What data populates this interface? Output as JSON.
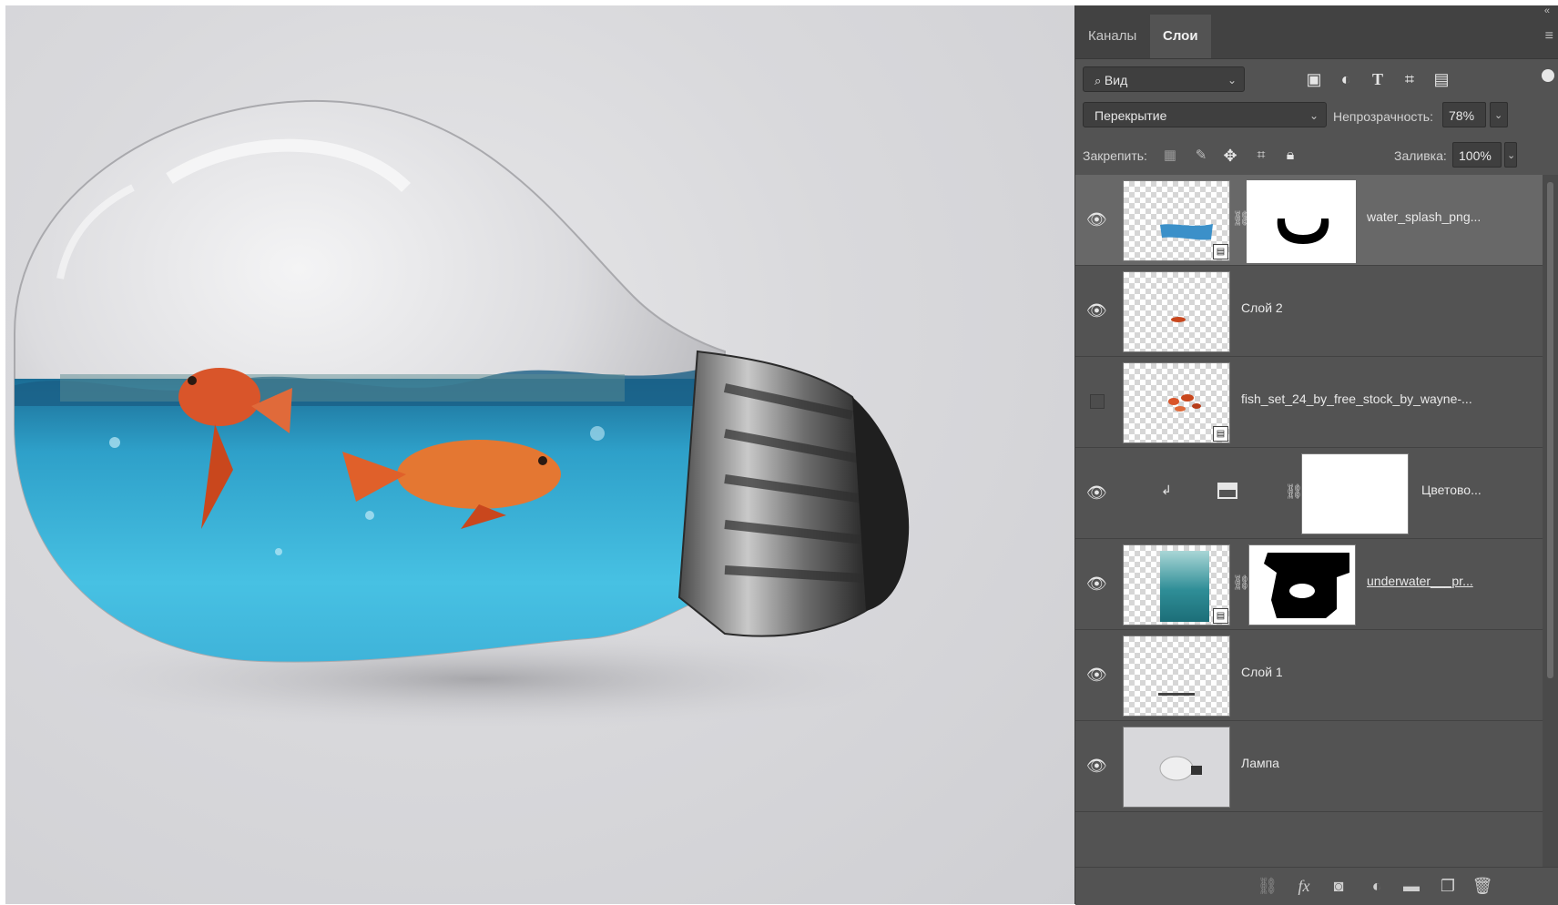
{
  "panel": {
    "tabs": [
      {
        "label": "Каналы"
      },
      {
        "label": "Слои"
      }
    ],
    "filter": {
      "label": "Вид"
    },
    "blend_mode": "Перекрытие",
    "opacity_label": "Непрозрачность:",
    "opacity_value": "78%",
    "lock_label": "Закрепить:",
    "fill_label": "Заливка:",
    "fill_value": "100%",
    "layers": [
      {
        "name": "water_splash_png...",
        "visible": true,
        "selected": true,
        "mask": true,
        "smart_object": true
      },
      {
        "name": "Слой 2",
        "visible": true
      },
      {
        "name": "fish_set_24_by_free_stock_by_wayne-...",
        "visible": false,
        "smart_object": true
      },
      {
        "name": "Цветово...",
        "visible": true,
        "adjustment": true,
        "clipped": true
      },
      {
        "name": "underwater___pr...",
        "visible": true,
        "mask": true,
        "smart_object": true
      },
      {
        "name": "Слой 1",
        "visible": true
      },
      {
        "name": "Лампа",
        "visible": true
      }
    ]
  },
  "icons": {
    "filter_kinds": [
      "image-filter-icon",
      "adjustment-filter-icon",
      "type-filter-icon",
      "shape-filter-icon",
      "smart-object-filter-icon"
    ],
    "lock": [
      "lock-transparent-icon",
      "lock-pixels-icon",
      "lock-position-icon",
      "lock-artboard-icon",
      "lock-all-icon"
    ],
    "bottom": [
      "link-layers-icon",
      "fx-icon",
      "add-mask-icon",
      "adjustment-layer-icon",
      "new-group-icon",
      "new-layer-icon",
      "delete-icon"
    ]
  },
  "colors": {
    "panel_bg": "#535353",
    "selected_layer_bg": "#686868",
    "water": "#3aa6c9",
    "fish": "#e0602a"
  }
}
